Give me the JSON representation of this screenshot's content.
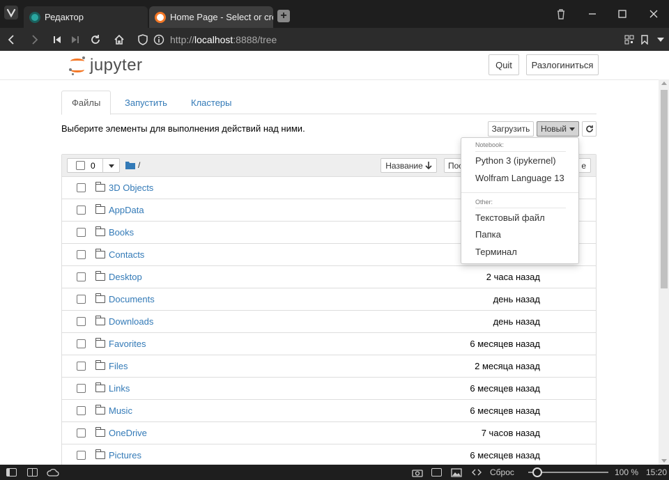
{
  "browser": {
    "tabs": [
      {
        "title": "Редактор"
      },
      {
        "title": "Home Page - Select or crea"
      }
    ],
    "new_tab": "+",
    "address": {
      "scheme": "http://",
      "host": "localhost",
      "rest": ":8888/tree"
    }
  },
  "header": {
    "logo_text": "jupyter",
    "quit_label": "Quit",
    "logout_label": "Разлогиниться"
  },
  "nav_tabs": [
    "Файлы",
    "Запустить",
    "Кластеры"
  ],
  "toolbar": {
    "hint": "Выберите элементы для выполнения действий над ними.",
    "upload_label": "Загрузить",
    "new_label": "Новый",
    "refresh_icon": "refresh-icon"
  },
  "list_header": {
    "selected_count": "0",
    "path": "/",
    "sort_name_label": "Название",
    "sort_modified_label": "Пос",
    "sort_size_label": "e"
  },
  "files": [
    {
      "name": "3D Objects",
      "modified": ""
    },
    {
      "name": "AppData",
      "modified": ""
    },
    {
      "name": "Books",
      "modified": ""
    },
    {
      "name": "Contacts",
      "modified": ""
    },
    {
      "name": "Desktop",
      "modified": "2 часа назад"
    },
    {
      "name": "Documents",
      "modified": "день назад"
    },
    {
      "name": "Downloads",
      "modified": "день назад"
    },
    {
      "name": "Favorites",
      "modified": "6 месяцев назад"
    },
    {
      "name": "Files",
      "modified": "2 месяца назад"
    },
    {
      "name": "Links",
      "modified": "6 месяцев назад"
    },
    {
      "name": "Music",
      "modified": "6 месяцев назад"
    },
    {
      "name": "OneDrive",
      "modified": "7 часов назад"
    },
    {
      "name": "Pictures",
      "modified": "6 месяцев назад"
    }
  ],
  "new_menu": {
    "notebook_header": "Notebook:",
    "notebook_items": [
      "Python 3 (ipykernel)",
      "Wolfram Language 13"
    ],
    "other_header": "Other:",
    "other_items": [
      "Текстовый файл",
      "Папка",
      "Терминал"
    ]
  },
  "statusbar": {
    "reset_label": "Сброс",
    "zoom": "100 %",
    "time": "15:20",
    "zoom_level_fraction": 0.05
  }
}
